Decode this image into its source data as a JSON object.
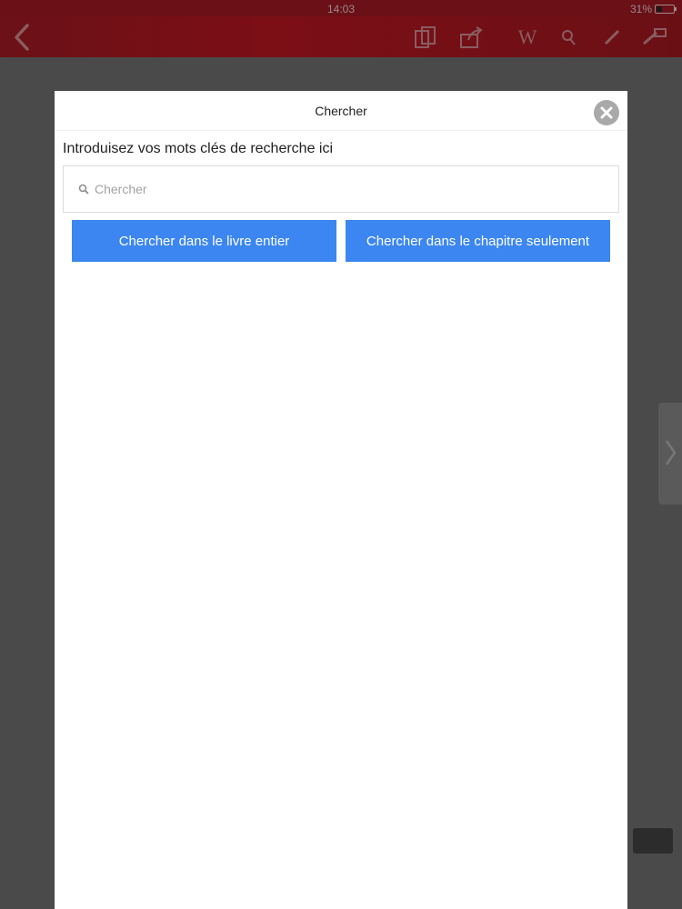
{
  "status_bar": {
    "time": "14:03",
    "battery": "31%"
  },
  "toolbar": {
    "icons": [
      "back-icon",
      "copy-icon",
      "share-icon",
      "wikipedia-icon",
      "search-icon",
      "edit-icon",
      "highlight-icon"
    ],
    "wikipedia_glyph": "W"
  },
  "modal": {
    "title": "Chercher",
    "prompt": "Introduisez vos mots clés de recherche ici",
    "search_placeholder": "Chercher",
    "search_value": "",
    "buttons": {
      "whole_book": "Chercher dans le livre entier",
      "chapter_only": "Chercher dans le chapitre seulement"
    }
  },
  "colors": {
    "accent_blue": "#3b86f1",
    "toolbar_red": "#7c0e16",
    "overlay": "#4a4a4a"
  }
}
